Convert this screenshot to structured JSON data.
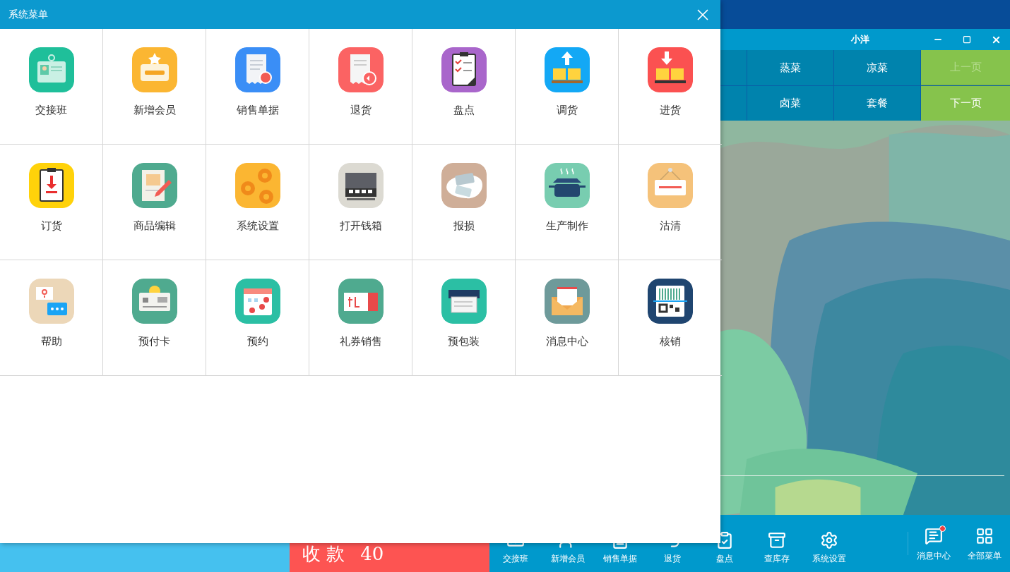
{
  "menu_window": {
    "title": "系统菜单",
    "items": [
      {
        "label": "交接班"
      },
      {
        "label": "新增会员"
      },
      {
        "label": "销售单据"
      },
      {
        "label": "退货"
      },
      {
        "label": "盘点"
      },
      {
        "label": "调货"
      },
      {
        "label": "进货"
      },
      {
        "label": "订货"
      },
      {
        "label": "商品编辑"
      },
      {
        "label": "系统设置"
      },
      {
        "label": "打开钱箱"
      },
      {
        "label": "报损"
      },
      {
        "label": "生产制作"
      },
      {
        "label": "沽清"
      },
      {
        "label": "帮助"
      },
      {
        "label": "预付卡"
      },
      {
        "label": "预约"
      },
      {
        "label": "礼券销售"
      },
      {
        "label": "预包装"
      },
      {
        "label": "消息中心"
      },
      {
        "label": "核销"
      }
    ]
  },
  "pos_window": {
    "title": "小洋",
    "categories": [
      {
        "label": "蒸菜"
      },
      {
        "label": "凉菜"
      },
      {
        "label": "卤菜"
      },
      {
        "label": "套餐"
      }
    ],
    "pager": [
      {
        "label": "上一页",
        "disabled": true
      },
      {
        "label": "下一页",
        "disabled": false
      }
    ]
  },
  "checkout": {
    "label": "收 款",
    "amount": "40"
  },
  "toolbar": [
    {
      "label": "交接班"
    },
    {
      "label": "新增会员"
    },
    {
      "label": "销售单据"
    },
    {
      "label": "退货"
    },
    {
      "label": "盘点"
    },
    {
      "label": "查库存"
    },
    {
      "label": "系统设置"
    }
  ],
  "toolbar_right": [
    {
      "label": "消息中心",
      "unread": true
    },
    {
      "label": "全部菜单",
      "unread": false
    }
  ]
}
